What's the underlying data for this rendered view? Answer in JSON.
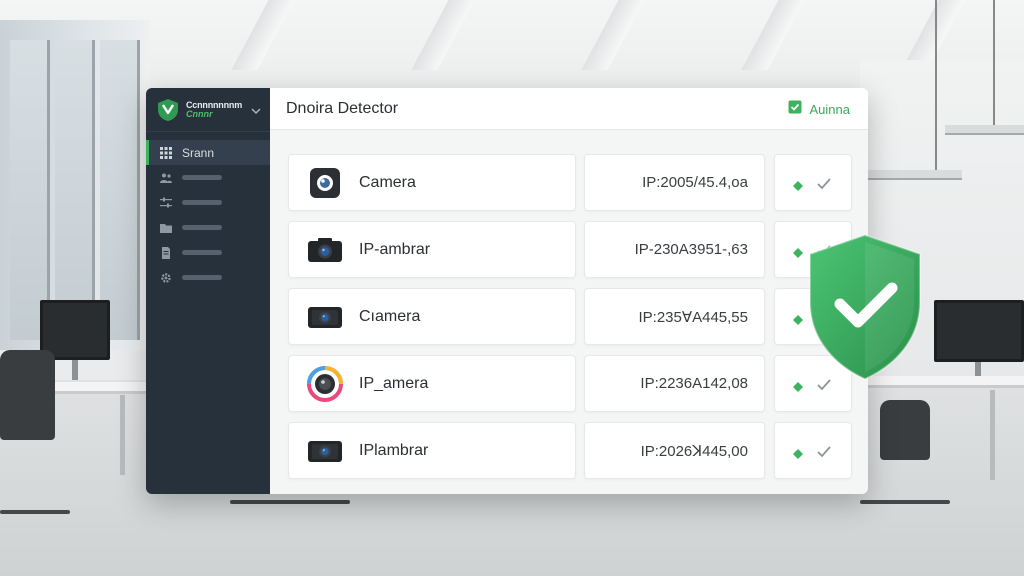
{
  "brand": {
    "line1": "Ccnnnnnnnm",
    "line2": "Cnnnr"
  },
  "sidebar": {
    "items": [
      {
        "label": "Srann",
        "icon": "grid-icon",
        "active": true
      },
      {
        "label": "",
        "icon": "users-icon",
        "active": false
      },
      {
        "label": "",
        "icon": "sliders-icon",
        "active": false
      },
      {
        "label": "",
        "icon": "folder-icon",
        "active": false
      },
      {
        "label": "",
        "icon": "document-icon",
        "active": false
      },
      {
        "label": "",
        "icon": "gear-icon",
        "active": false
      }
    ]
  },
  "header": {
    "title": "Dnoira Detector",
    "user": "Auinna"
  },
  "devices": [
    {
      "name": "Camera",
      "ip": "IP:2005/45.4,oa",
      "icon": "camera-circle-icon"
    },
    {
      "name": "IP-ambrar",
      "ip": "IP-230A3951-,63",
      "icon": "camera-icon"
    },
    {
      "name": "Cıamera",
      "ip": "IP:235ⱯA445,55",
      "icon": "camera-icon"
    },
    {
      "name": "IP_amera",
      "ip": "IP:2236A142,08",
      "icon": "camera-color-icon"
    },
    {
      "name": "IPlambrar",
      "ip": "IP:2026ꓘ445,00",
      "icon": "camera-icon"
    }
  ],
  "colors": {
    "accent": "#3db35f",
    "sidebar": "#27313c",
    "shield": "#36a85a"
  }
}
